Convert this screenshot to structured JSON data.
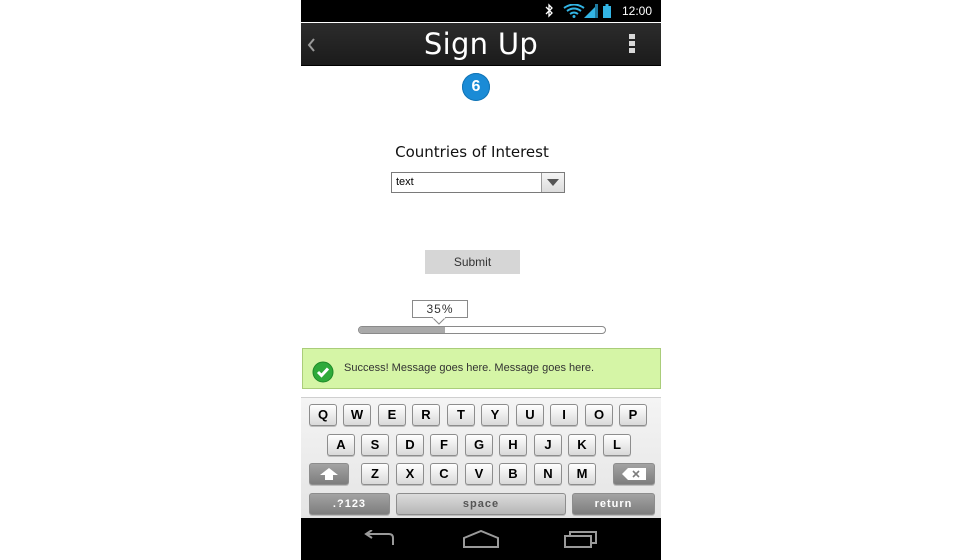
{
  "status_bar": {
    "time": "12:00"
  },
  "action_bar": {
    "title": "Sign Up"
  },
  "step": {
    "number": "6"
  },
  "form": {
    "label": "Countries of Interest",
    "select_value": "text",
    "submit_label": "Submit"
  },
  "progress": {
    "label": "35%",
    "value": 0.35
  },
  "message": {
    "text": "Success! Message goes here. Message goes here."
  },
  "keyboard": {
    "row1": [
      "Q",
      "W",
      "E",
      "R",
      "T",
      "Y",
      "U",
      "I",
      "O",
      "P"
    ],
    "row2": [
      "A",
      "S",
      "D",
      "F",
      "G",
      "H",
      "J",
      "K",
      "L"
    ],
    "row3": [
      "Z",
      "X",
      "C",
      "V",
      "B",
      "N",
      "M"
    ],
    "symbols_label": ".?123",
    "space_label": "space",
    "return_label": "return"
  },
  "colors": {
    "badge": "#1a8bd6",
    "success_bg": "#d5f5a6",
    "success_check": "#2eaa3a"
  }
}
